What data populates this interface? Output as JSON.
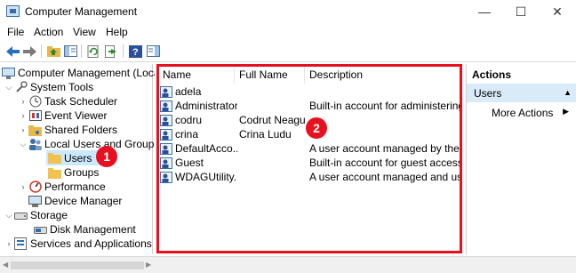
{
  "window": {
    "title": "Computer Management",
    "minimize_glyph": "—",
    "maximize_glyph": "☐",
    "close_glyph": "✕"
  },
  "menu": [
    "File",
    "Action",
    "View",
    "Help"
  ],
  "toolbar_icons": [
    "back-arrow-icon",
    "forward-arrow-icon",
    "up-folder-icon",
    "show-hide-tree-icon",
    "refresh-icon",
    "export-list-icon",
    "help-icon",
    "show-hide-action-pane-icon"
  ],
  "tree": {
    "root": "Computer Management (Local)",
    "system_tools": "System Tools",
    "task_scheduler": "Task Scheduler",
    "event_viewer": "Event Viewer",
    "shared_folders": "Shared Folders",
    "local_users_groups": "Local Users and Groups",
    "users": "Users",
    "groups": "Groups",
    "performance": "Performance",
    "device_manager": "Device Manager",
    "storage": "Storage",
    "disk_management": "Disk Management",
    "services_apps": "Services and Applications"
  },
  "list": {
    "columns": [
      "Name",
      "Full Name",
      "Description"
    ],
    "rows": [
      {
        "name": "adela",
        "full_name": "",
        "description": ""
      },
      {
        "name": "Administrator",
        "full_name": "",
        "description": "Built-in account for administering..."
      },
      {
        "name": "codru",
        "full_name": "Codrut Neagu",
        "description": ""
      },
      {
        "name": "crina",
        "full_name": "Crina Ludu",
        "description": ""
      },
      {
        "name": "DefaultAcco...",
        "full_name": "",
        "description": "A user account managed by the s..."
      },
      {
        "name": "Guest",
        "full_name": "",
        "description": "Built-in account for guest access t..."
      },
      {
        "name": "WDAGUtility...",
        "full_name": "",
        "description": "A user account managed and use..."
      }
    ]
  },
  "actions": {
    "header": "Actions",
    "section": "Users",
    "more": "More Actions"
  },
  "markers": [
    "1",
    "2"
  ],
  "colors": {
    "highlight": "#e8101e",
    "selection": "#cce8ff",
    "actions_section": "#d9ebf9"
  }
}
